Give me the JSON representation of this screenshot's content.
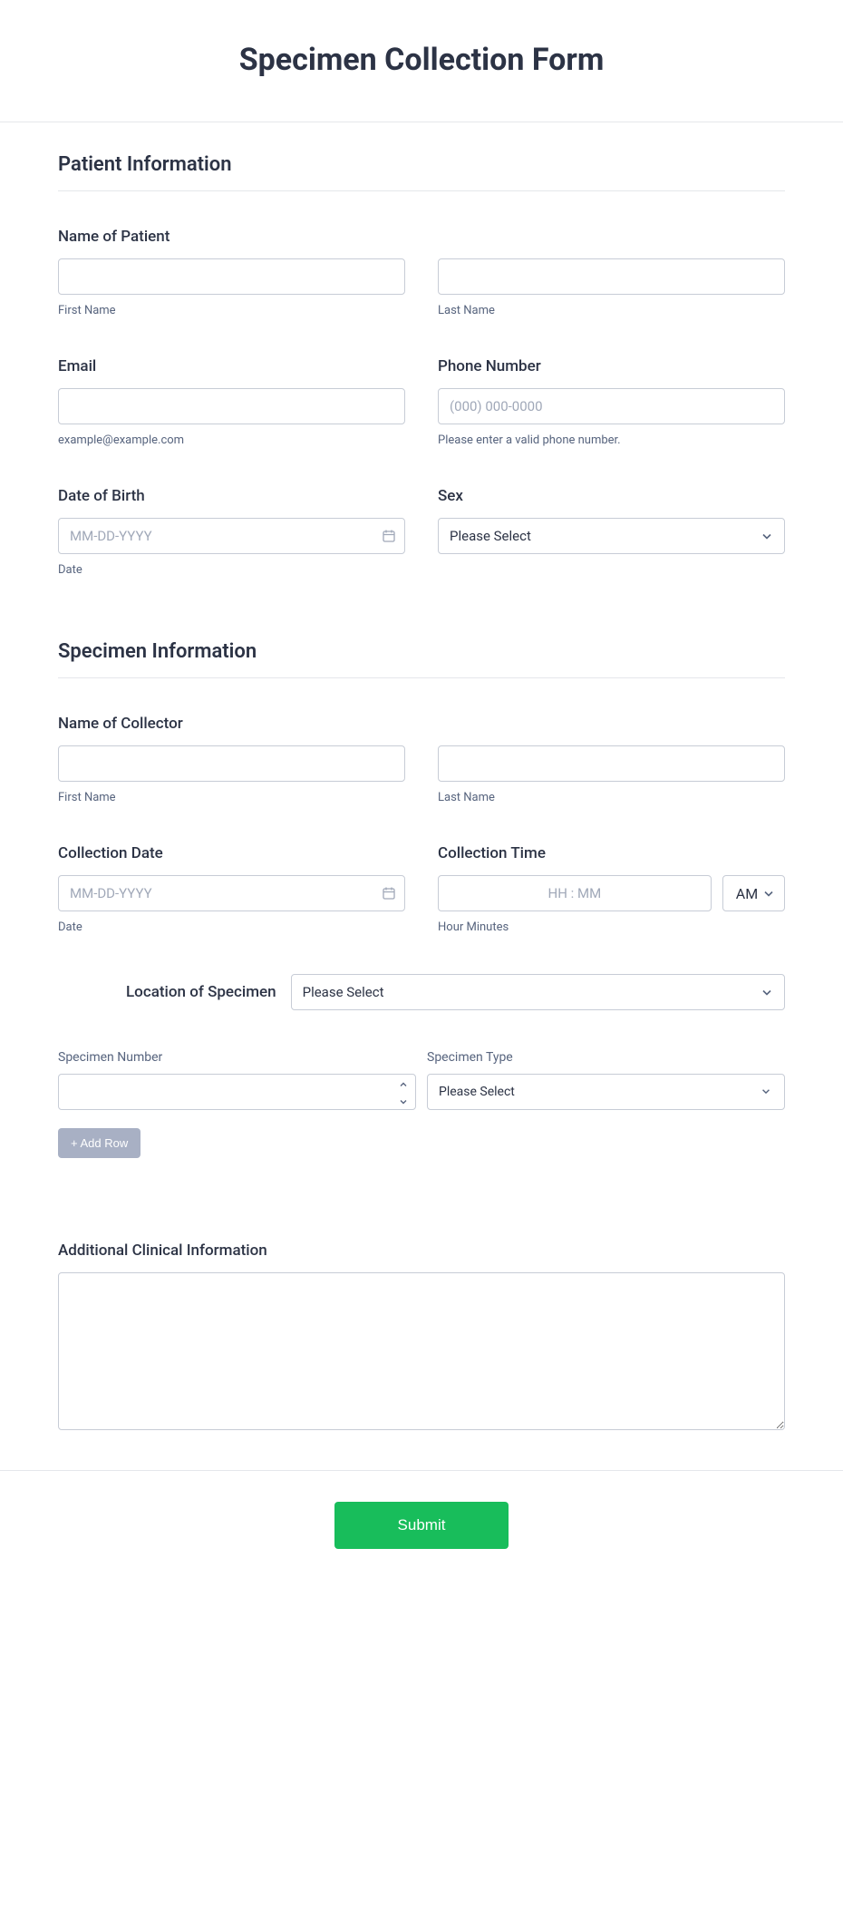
{
  "form_title": "Specimen Collection Form",
  "patient": {
    "section_title": "Patient Information",
    "name_label": "Name of Patient",
    "first_name_sublabel": "First Name",
    "last_name_sublabel": "Last Name",
    "email_label": "Email",
    "email_sublabel": "example@example.com",
    "phone_label": "Phone Number",
    "phone_placeholder": "(000) 000-0000",
    "phone_sublabel": "Please enter a valid phone number.",
    "dob_label": "Date of Birth",
    "dob_placeholder": "MM-DD-YYYY",
    "dob_sublabel": "Date",
    "sex_label": "Sex",
    "sex_selected": "Please Select"
  },
  "specimen": {
    "section_title": "Specimen Information",
    "collector_label": "Name of Collector",
    "first_name_sublabel": "First Name",
    "last_name_sublabel": "Last Name",
    "collection_date_label": "Collection Date",
    "collection_date_placeholder": "MM-DD-YYYY",
    "collection_date_sublabel": "Date",
    "collection_time_label": "Collection Time",
    "collection_time_placeholder": "HH : MM",
    "collection_time_sublabel": "Hour Minutes",
    "ampm_selected": "AM",
    "location_label": "Location of Specimen",
    "location_selected": "Please Select",
    "specimen_number_label": "Specimen Number",
    "specimen_type_label": "Specimen Type",
    "specimen_type_selected": "Please Select",
    "add_row_label": "+ Add Row"
  },
  "additional": {
    "label": "Additional Clinical Information"
  },
  "submit_label": "Submit"
}
